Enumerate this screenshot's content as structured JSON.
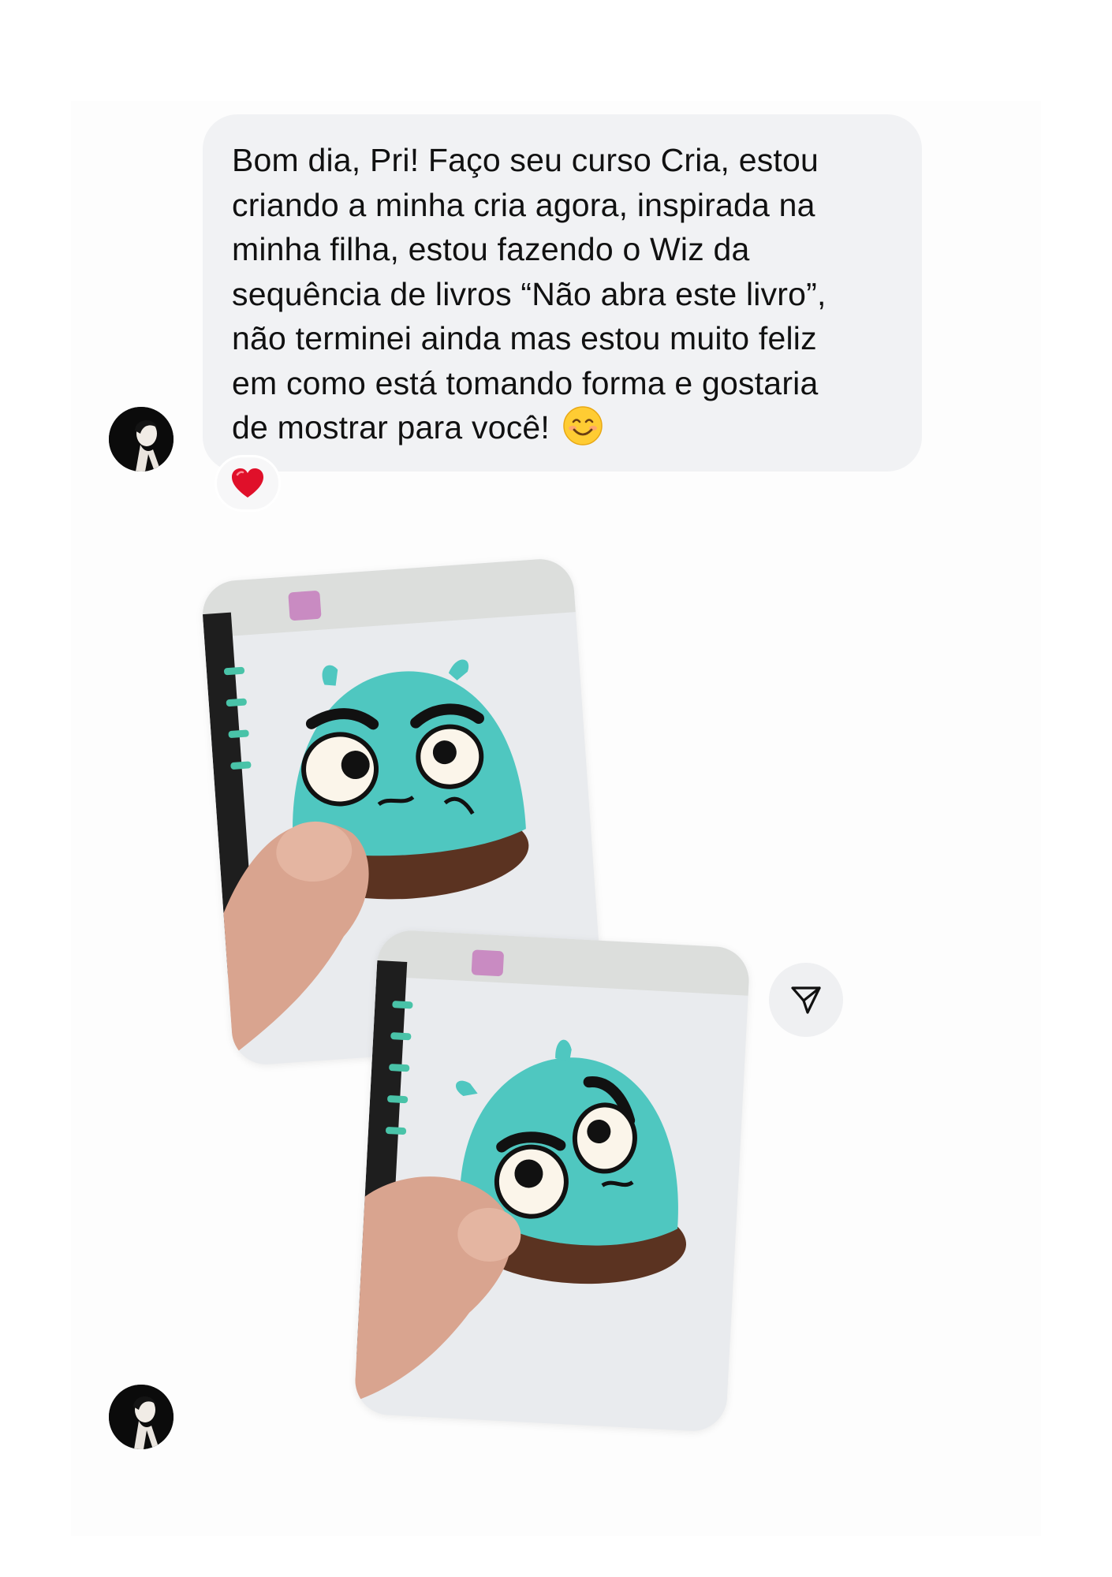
{
  "conversation": {
    "message": {
      "text": "Bom dia, Pri! Faço seu curso Cria, estou\ncriando a minha cria agora, inspirada na\nminha filha, estou fazendo o Wiz da\nsequência de livros “Não abra este livro”,\nnão terminei ainda mas estou muito feliz\nem como está tomando forma e gostaria\nde mostrar para você!",
      "emoji": "smiling-face-with-smiling-eyes",
      "reaction": "red-heart"
    },
    "photos": [
      {
        "subject": "crochet-wiz-toy-front"
      },
      {
        "subject": "crochet-wiz-toy-angled"
      }
    ],
    "share_icon": "paper-plane-icon"
  },
  "colors": {
    "bubble_bg": "#f1f2f4",
    "text": "#111111",
    "heart": "#e0102a",
    "toy_teal": "#4fc7c0",
    "toy_brown": "#5b3321"
  }
}
